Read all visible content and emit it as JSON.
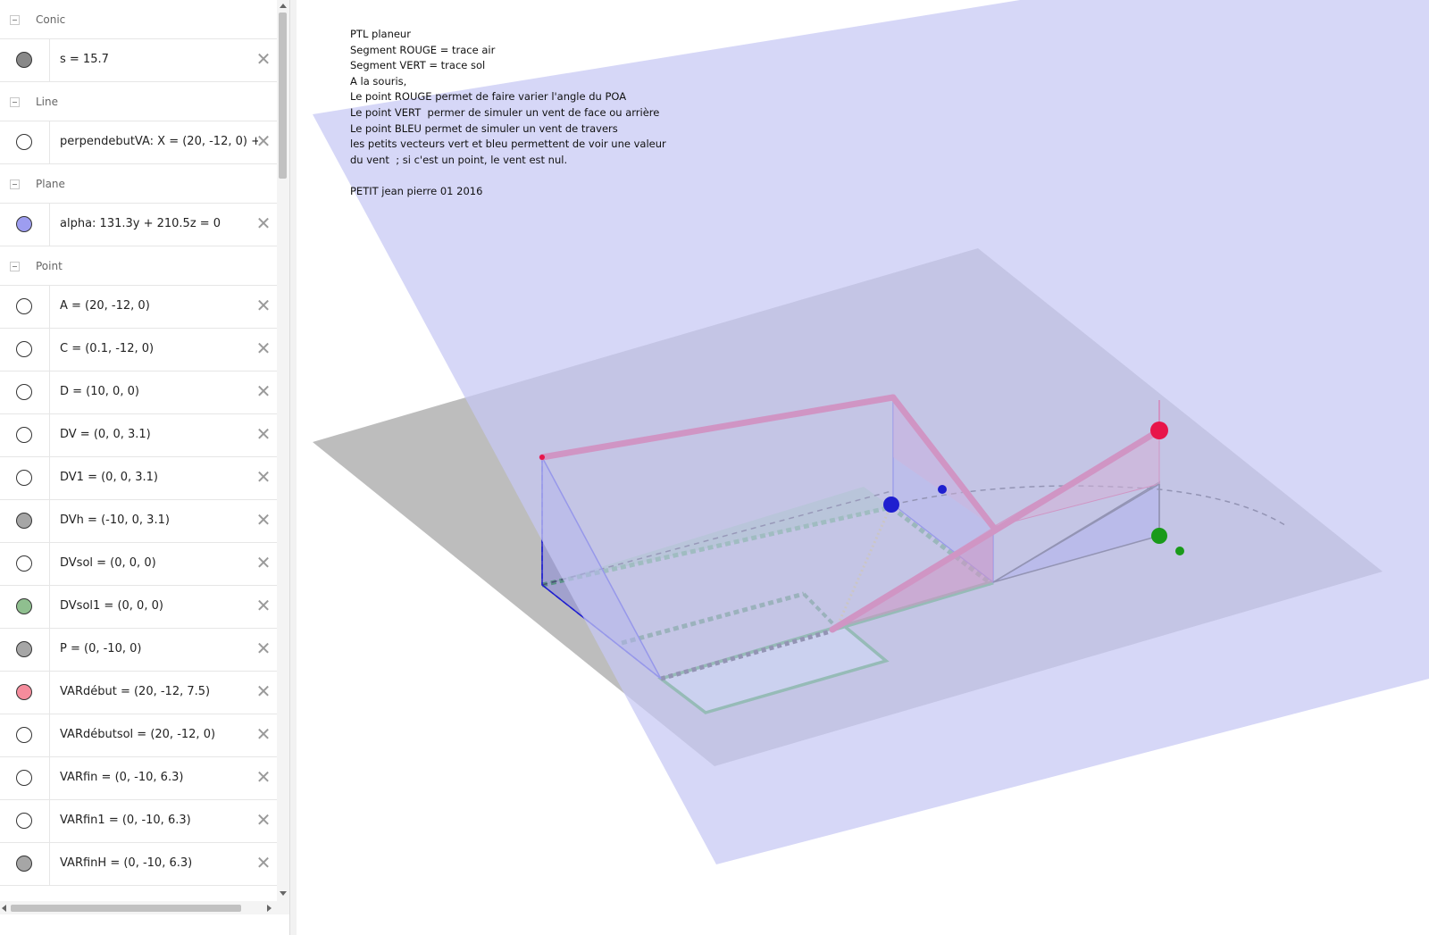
{
  "algebra": {
    "groups": [
      {
        "label": "Conic",
        "items": [
          {
            "expr": "s = 15.7",
            "color": "#888888"
          }
        ]
      },
      {
        "label": "Line",
        "items": [
          {
            "expr": "perpendebutVA: X = (20, -12, 0) + λ (0,",
            "color": "#ffffff"
          }
        ]
      },
      {
        "label": "Plane",
        "items": [
          {
            "expr": "alpha: 131.3y + 210.5z = 0",
            "color": "#9d9df0"
          }
        ]
      },
      {
        "label": "Point",
        "items": [
          {
            "expr": "A = (20, -12, 0)",
            "color": "#ffffff"
          },
          {
            "expr": "C = (0.1, -12, 0)",
            "color": "#ffffff"
          },
          {
            "expr": "D = (10, 0, 0)",
            "color": "#ffffff"
          },
          {
            "expr": "DV = (0, 0, 3.1)",
            "color": "#ffffff"
          },
          {
            "expr": "DV1 = (0, 0, 3.1)",
            "color": "#ffffff"
          },
          {
            "expr": "DVh = (-10, 0, 3.1)",
            "color": "#a6a6a6"
          },
          {
            "expr": "DVsol = (0, 0, 0)",
            "color": "#ffffff"
          },
          {
            "expr": "DVsol1 = (0, 0, 0)",
            "color": "#8fbf8f"
          },
          {
            "expr": "P = (0, -10, 0)",
            "color": "#a6a6a6"
          },
          {
            "expr": "VARdébut = (20, -12, 7.5)",
            "color": "#f58c9c"
          },
          {
            "expr": "VARdébutsol = (20, -12, 0)",
            "color": "#ffffff"
          },
          {
            "expr": "VARfin = (0, -10, 6.3)",
            "color": "#ffffff"
          },
          {
            "expr": "VARfin1 = (0, -10, 6.3)",
            "color": "#ffffff"
          },
          {
            "expr": "VARfinH = (0, -10, 6.3)",
            "color": "#a6a6a6"
          }
        ]
      }
    ],
    "delete_icon": "close-icon",
    "delete_glyph": "✕"
  },
  "graphics": {
    "info_lines": [
      "PTL planeur",
      "Segment ROUGE = trace air",
      "Segment VERT = trace sol",
      "A la souris,",
      "Le point ROUGE permet de faire varier l'angle du POA",
      "Le point VERT  permer de simuler un vent de face ou arrière",
      "Le point BLEU permet de simuler un vent de travers",
      "les petits vecteurs vert et bleu permettent de voir une valeur",
      "du vent  ; si c'est un point, le vent est nul.",
      "",
      "PETIT jean pierre 01 2016"
    ],
    "colors": {
      "red": "#e8154a",
      "green": "#1a9a1a",
      "blue": "#1f1fcf",
      "plane_alpha": "#c9caf2",
      "ground": "#b5b5b5"
    }
  }
}
